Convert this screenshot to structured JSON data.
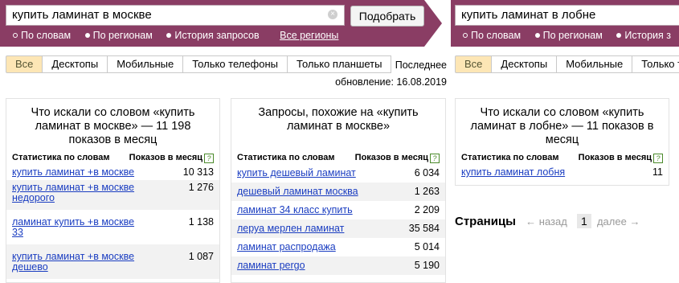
{
  "left": {
    "query": "купить ламинат в москве",
    "clear": "×",
    "submit": "Подобрать",
    "modes": [
      "По словам",
      "По регионам",
      "История запросов"
    ],
    "regions_link": "Все регионы",
    "tabs": [
      "Все",
      "Десктопы",
      "Мобильные",
      "Только телефоны",
      "Только планшеты"
    ],
    "updated_line1": "Последнее",
    "updated_line2": "обновление: 16.08.2019",
    "panel1": {
      "title": "Что искали со словом «купить ламинат в москве» — 11 198 показов в месяц",
      "col_words": "Статистика по словам",
      "col_shows": "Показов в месяц",
      "help": "?",
      "rows": [
        {
          "q": "купить ламинат +в москве",
          "n": "10 313"
        },
        {
          "q": "купить ламинат +в москве недорого",
          "n": "1 276"
        },
        {
          "q": "ламинат купить +в москве 33",
          "n": "1 138"
        },
        {
          "q": "купить ламинат +в москве дешево",
          "n": "1 087"
        }
      ]
    },
    "panel2": {
      "title": "Запросы, похожие на «купить ламинат в москве»",
      "col_words": "Статистика по словам",
      "col_shows": "Показов в месяц",
      "help": "?",
      "rows": [
        {
          "q": "купить дешевый ламинат",
          "n": "6 034"
        },
        {
          "q": "дешевый ламинат москва",
          "n": "1 263"
        },
        {
          "q": "ламинат 34 класс купить",
          "n": "2 209"
        },
        {
          "q": "леруа мерлен ламинат",
          "n": "35 584"
        },
        {
          "q": "ламинат распродажа",
          "n": "5 014"
        },
        {
          "q": "ламинат pergo",
          "n": "5 190"
        }
      ]
    }
  },
  "right": {
    "query": "купить ламинат в лобне",
    "modes": [
      "По словам",
      "По регионам",
      "История з"
    ],
    "tabs": [
      "Все",
      "Десктопы",
      "Мобильные",
      "Только т"
    ],
    "panel": {
      "title": "Что искали со словом «купить ламинат в лобне» — 11 показов в месяц",
      "col_words": "Статистика по словам",
      "col_shows": "Показов в месяц",
      "help": "?",
      "rows": [
        {
          "q": "купить ламинат лобня",
          "n": "11"
        }
      ]
    },
    "pager": {
      "title": "Страницы",
      "prev": "← назад",
      "current": "1",
      "next": "далее →"
    }
  }
}
